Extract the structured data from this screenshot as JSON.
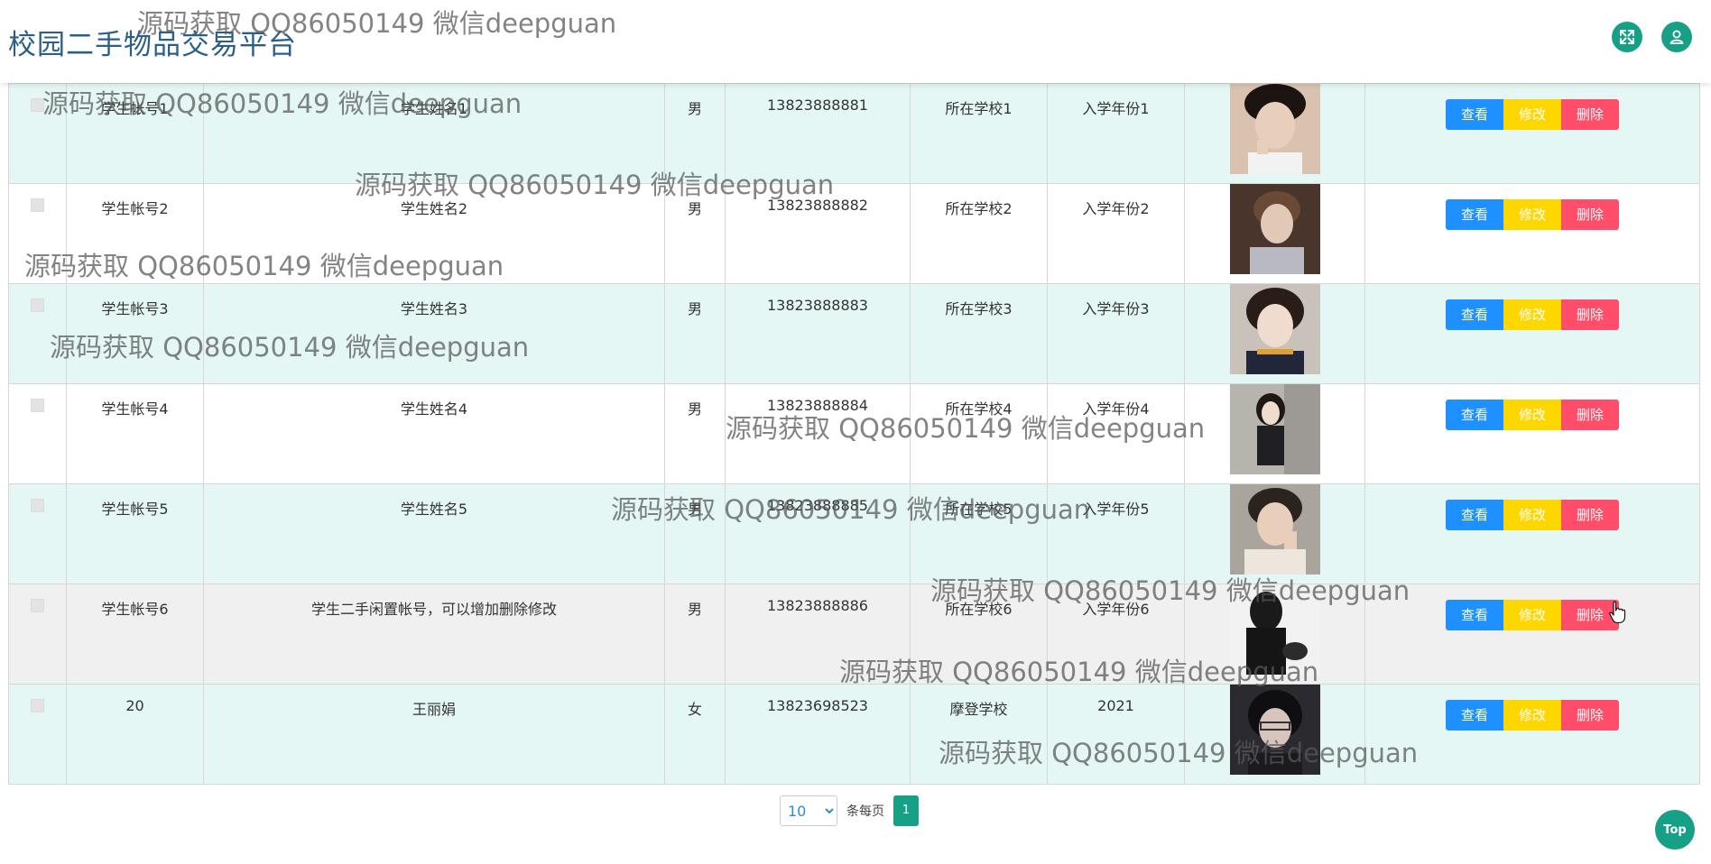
{
  "header": {
    "app_title": "校园二手物品交易平台"
  },
  "table": {
    "rows": [
      {
        "account": "学生帐号1",
        "name": "学生姓名1",
        "gender": "男",
        "phone": "13823888881",
        "school": "所在学校1",
        "year": "入学年份1",
        "photo": "student-photo-1"
      },
      {
        "account": "学生帐号2",
        "name": "学生姓名2",
        "gender": "男",
        "phone": "13823888882",
        "school": "所在学校2",
        "year": "入学年份2",
        "photo": "student-photo-2"
      },
      {
        "account": "学生帐号3",
        "name": "学生姓名3",
        "gender": "男",
        "phone": "13823888883",
        "school": "所在学校3",
        "year": "入学年份3",
        "photo": "student-photo-3"
      },
      {
        "account": "学生帐号4",
        "name": "学生姓名4",
        "gender": "男",
        "phone": "13823888884",
        "school": "所在学校4",
        "year": "入学年份4",
        "photo": "student-photo-4"
      },
      {
        "account": "学生帐号5",
        "name": "学生姓名5",
        "gender": "男",
        "phone": "13823888885",
        "school": "所在学校5",
        "year": "入学年份5",
        "photo": "student-photo-5"
      },
      {
        "account": "学生帐号6",
        "name": "学生二手闲置帐号，可以增加删除修改",
        "gender": "男",
        "phone": "13823888886",
        "school": "所在学校6",
        "year": "入学年份6",
        "photo": "student-photo-6"
      },
      {
        "account": "20",
        "name": "王丽娟",
        "gender": "女",
        "phone": "13823698523",
        "school": "摩登学校",
        "year": "2021",
        "photo": "student-photo-7"
      }
    ],
    "actions": {
      "view_label": "查看",
      "edit_label": "修改",
      "delete_label": "删除"
    }
  },
  "pagination": {
    "page_size": "10",
    "page_size_options": [
      "10"
    ],
    "per_page_label": "条每页",
    "current_page": "1"
  },
  "top_button": {
    "label": "Top"
  },
  "watermark": {
    "text": "源码获取 QQ86050149 微信deepguan"
  },
  "colors": {
    "accent": "#16a085",
    "view": "#1e90ff",
    "edit": "#ffd700",
    "delete": "#ff4d6a",
    "row_alt": "#e4f7f5",
    "title": "#2b5f8a"
  },
  "icons": {
    "fullscreen": "fullscreen-icon",
    "user": "user-icon"
  }
}
